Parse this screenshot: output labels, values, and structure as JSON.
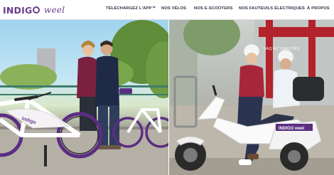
{
  "header": {
    "logo": {
      "brand": "INDIGO",
      "sub": "weel"
    },
    "nav": [
      {
        "label": "TÉLÉCHARGEZ L'APP",
        "has_dropdown": true
      },
      {
        "label": "NOS VÉLOS"
      },
      {
        "label": "NOS E-SCOOTERS"
      },
      {
        "label": "NOS FAUTEUILS ÉLECTRIQUES"
      },
      {
        "label": "À PROPOS"
      }
    ]
  },
  "hero": {
    "left_bike_decal": "indigo",
    "right_scooter_decal": "INDIGO weel",
    "overlay_text": "FAQ ACTUALITÉS"
  },
  "colors": {
    "brand_purple": "#6b3c8e",
    "nav_text": "#3a2a46"
  }
}
